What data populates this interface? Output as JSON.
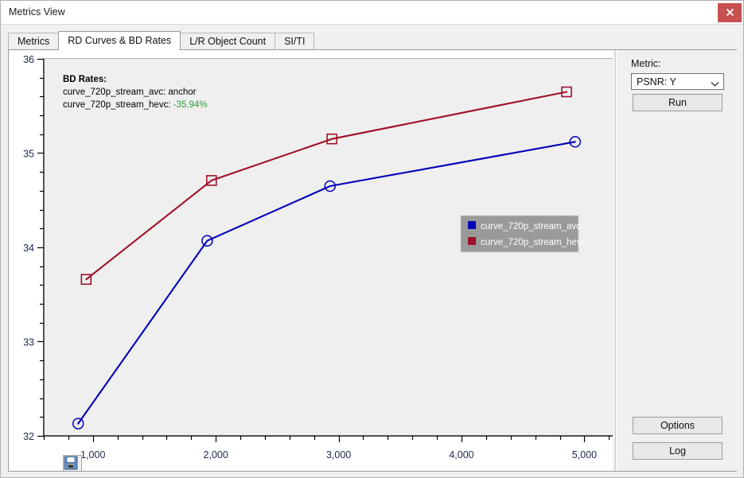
{
  "window": {
    "title": "Metrics View",
    "close_label": "✕"
  },
  "tabs": [
    {
      "label": "Metrics",
      "active": false
    },
    {
      "label": "RD Curves & BD Rates",
      "active": true
    },
    {
      "label": "L/R Object Count",
      "active": false
    },
    {
      "label": "SI/TI",
      "active": false
    }
  ],
  "right_panel": {
    "metric_label": "Metric:",
    "metric_value": "PSNR: Y",
    "metric_options": [
      "PSNR: Y"
    ],
    "run_label": "Run",
    "options_label": "Options",
    "log_label": "Log"
  },
  "plot_toolbar": {
    "save_icon": "floppy-disk-save-icon"
  },
  "annotation": {
    "title": "BD Rates:",
    "rows": [
      {
        "name": "curve_720p_stream_avc:",
        "value": "anchor",
        "value_color": "#000000"
      },
      {
        "name": "curve_720p_stream_hevc:",
        "value": "-35.94%",
        "value_color": "#2e9b3e"
      }
    ]
  },
  "chart_data": {
    "type": "line",
    "title": "",
    "xlabel": "",
    "ylabel": "",
    "xlim": [
      600,
      5250
    ],
    "ylim": [
      32,
      36
    ],
    "xticks": [
      1000,
      2000,
      3000,
      4000,
      5000
    ],
    "xticklabels": [
      "1,000",
      "2,000",
      "3,000",
      "4,000",
      "5,000"
    ],
    "yticks": [
      32,
      33,
      34,
      35,
      36
    ],
    "yticklabels": [
      "32",
      "33",
      "34",
      "35",
      "36"
    ],
    "y_minor_step": 0.2,
    "x_minor_step": 200,
    "grid": false,
    "legend_position": "center-right",
    "series": [
      {
        "name": "curve_720p_stream_avc",
        "color": "#0000bb",
        "marker": "circle",
        "x": [
          880,
          1930,
          2930,
          4925
        ],
        "y": [
          32.13,
          34.07,
          34.65,
          35.12
        ]
      },
      {
        "name": "curve_720p_stream_hevc",
        "color": "#a01028",
        "marker": "square",
        "x": [
          945,
          1965,
          2945,
          4855
        ],
        "y": [
          33.66,
          34.71,
          35.15,
          35.65
        ]
      }
    ]
  }
}
